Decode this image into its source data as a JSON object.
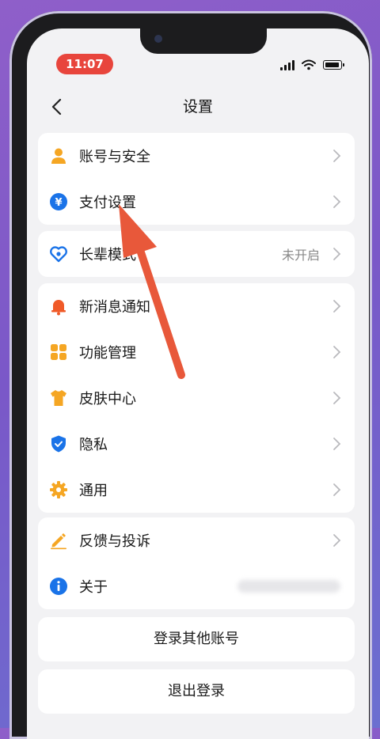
{
  "status_bar": {
    "time": "11:07"
  },
  "nav": {
    "title": "设置"
  },
  "groups": [
    {
      "items": [
        {
          "label": "账号与安全",
          "icon": "person-icon"
        },
        {
          "label": "支付设置",
          "icon": "yuan-icon"
        }
      ]
    },
    {
      "items": [
        {
          "label": "长辈模式",
          "value": "未开启",
          "icon": "heart-icon"
        }
      ]
    },
    {
      "items": [
        {
          "label": "新消息通知",
          "icon": "bell-icon"
        },
        {
          "label": "功能管理",
          "icon": "grid-icon"
        },
        {
          "label": "皮肤中心",
          "icon": "tshirt-icon"
        },
        {
          "label": "隐私",
          "icon": "shield-icon"
        },
        {
          "label": "通用",
          "icon": "gear-icon"
        }
      ]
    },
    {
      "items": [
        {
          "label": "反馈与投诉",
          "icon": "pencil-icon"
        },
        {
          "label": "关于",
          "icon": "info-icon"
        }
      ]
    }
  ],
  "buttons": {
    "switch_account": "登录其他账号",
    "logout": "退出登录"
  },
  "colors": {
    "accent_red": "#e8453c",
    "icon_orange": "#f5a623",
    "icon_blue": "#1a73e8",
    "bell_red": "#f05a28",
    "arrow": "#e8583a"
  }
}
